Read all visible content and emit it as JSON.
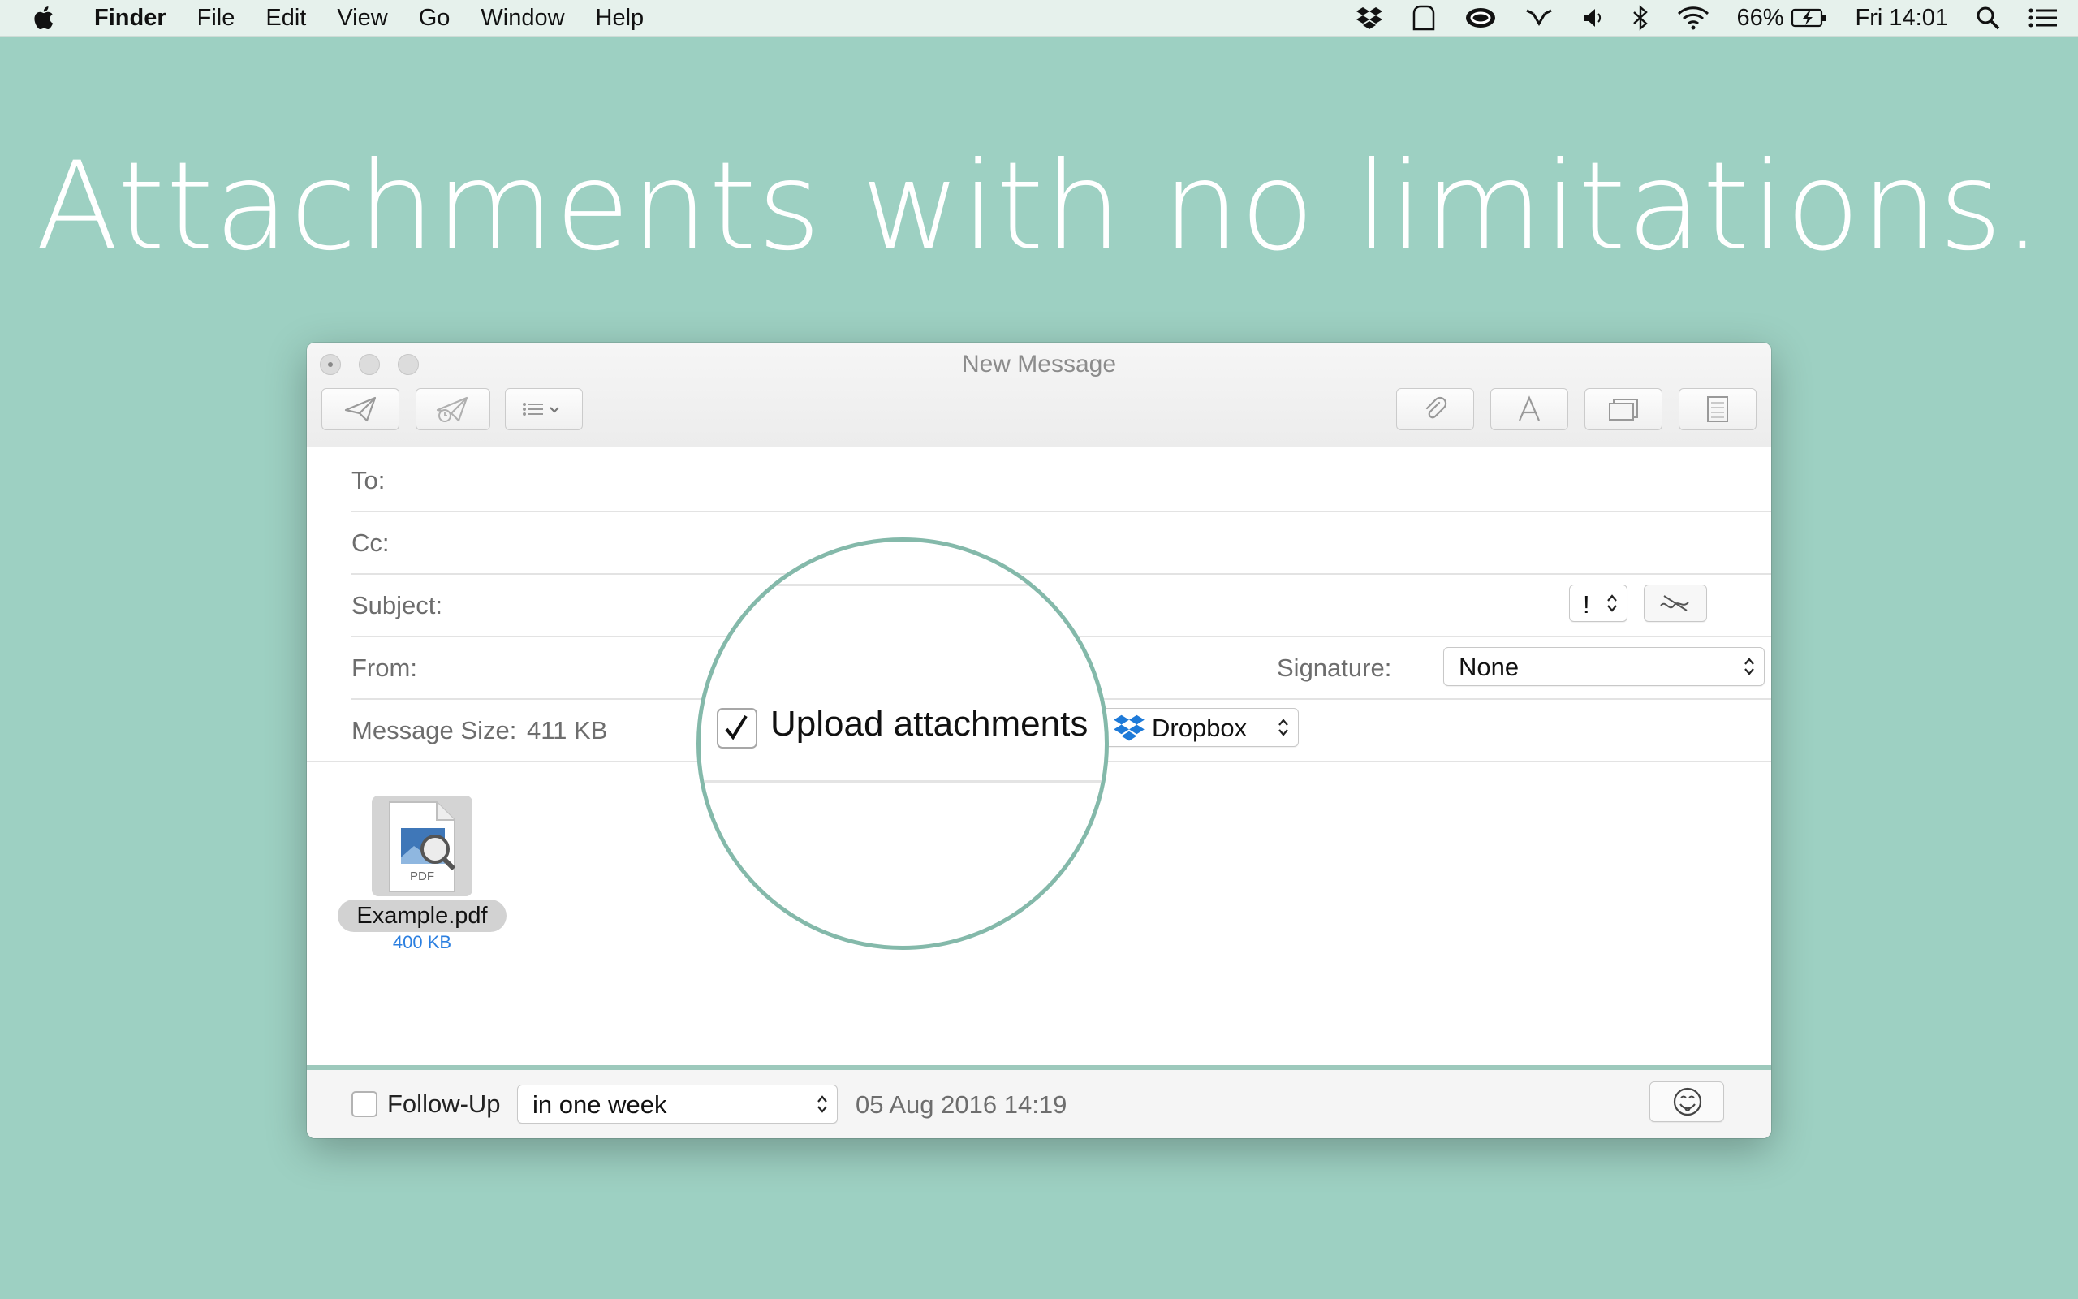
{
  "menubar": {
    "app_name": "Finder",
    "menus": [
      "File",
      "Edit",
      "View",
      "Go",
      "Window",
      "Help"
    ],
    "battery": "66%",
    "clock": "Fri 14:01"
  },
  "headline": "Attachments with no limitations.",
  "window": {
    "title": "New Message",
    "fields": {
      "to_label": "To:",
      "cc_label": "Cc:",
      "subject_label": "Subject:",
      "from_label": "From:",
      "signature_label": "Signature:",
      "signature_value": "None",
      "message_size_label": "Message Size:",
      "message_size_value": "411 KB",
      "priority_symbol": "!"
    },
    "upload": {
      "label": "Upload attachments",
      "checked": true,
      "service": "Dropbox"
    },
    "attachment": {
      "name": "Example.pdf",
      "size": "400 KB",
      "type_label": "PDF"
    },
    "footer": {
      "follow_up_label": "Follow-Up",
      "follow_up_checked": false,
      "follow_up_when": "in one week",
      "follow_up_date": "05 Aug 2016 14:19"
    }
  },
  "colors": {
    "background": "#9dd0c2",
    "magnifier_ring": "#84b9aa",
    "link_blue": "#2b7fe0",
    "dropbox_blue": "#1e7ad8"
  }
}
